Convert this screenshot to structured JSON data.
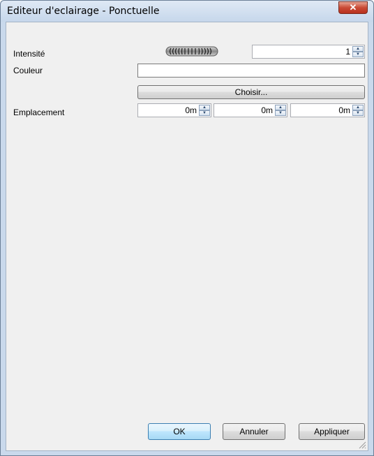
{
  "window": {
    "title": "Editeur d'eclairage - Ponctuelle",
    "close_symbol": "✕"
  },
  "form": {
    "intensity": {
      "label": "Intensité",
      "value": "1",
      "knob_icon": "knob-icon"
    },
    "color": {
      "label": "Couleur",
      "value": "",
      "choose_label": "Choisir..."
    },
    "location": {
      "label": "Emplacement",
      "x": "0m",
      "y": "0m",
      "z": "0m"
    }
  },
  "buttons": {
    "ok": "OK",
    "cancel": "Annuler",
    "apply": "Appliquer"
  },
  "colors": {
    "frame": "#c9d9ec",
    "client": "#f0f0f0",
    "close": "#c94a35",
    "default_button": "#3c7fb1"
  }
}
